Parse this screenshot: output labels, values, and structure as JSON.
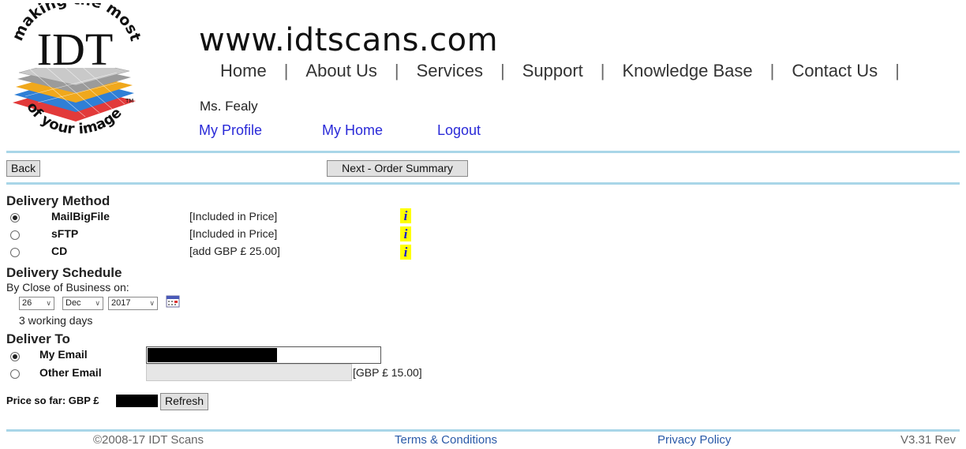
{
  "logo": {
    "top_text": "making the most",
    "center_text": "IDT",
    "bottom_text": "of your image",
    "trademark": "TM"
  },
  "header": {
    "site_title": "www.idtscans.com",
    "nav": [
      "Home",
      "About Us",
      "Services",
      "Support",
      "Knowledge Base",
      "Contact Us"
    ],
    "separator": "|",
    "user_name": "Ms. Fealy",
    "user_links": [
      "My Profile",
      "My Home",
      "Logout"
    ]
  },
  "toolbar": {
    "back_label": "Back",
    "next_label": "Next - Order Summary"
  },
  "delivery_method": {
    "title": "Delivery Method",
    "options": [
      {
        "label": "MailBigFile",
        "price": "[Included in Price]",
        "selected": true,
        "info": "i"
      },
      {
        "label": "sFTP",
        "price": "[Included in Price]",
        "selected": false,
        "info": "i"
      },
      {
        "label": "CD",
        "price": "[add GBP £ 25.00]",
        "selected": false,
        "info": "i"
      }
    ]
  },
  "delivery_schedule": {
    "title": "Delivery Schedule",
    "subtitle": "By Close of Business on:",
    "day": "26",
    "month": "Dec",
    "year": "2017",
    "working_days": "3 working days"
  },
  "deliver_to": {
    "title": "Deliver To",
    "my_email_label": "My Email",
    "other_email_label": "Other Email",
    "other_email_price": "[GBP £ 15.00]",
    "my_email_selected": true
  },
  "price": {
    "label": "Price so far: GBP £",
    "refresh_label": "Refresh"
  },
  "footer": {
    "copyright": "©2008-17 IDT Scans",
    "terms": "Terms & Conditions",
    "privacy": "Privacy Policy",
    "version": "V3.31 Rev"
  },
  "colors": {
    "link": "#2a2ad8",
    "rule": "#a9d6e8",
    "info_bg": "#ffff00"
  }
}
